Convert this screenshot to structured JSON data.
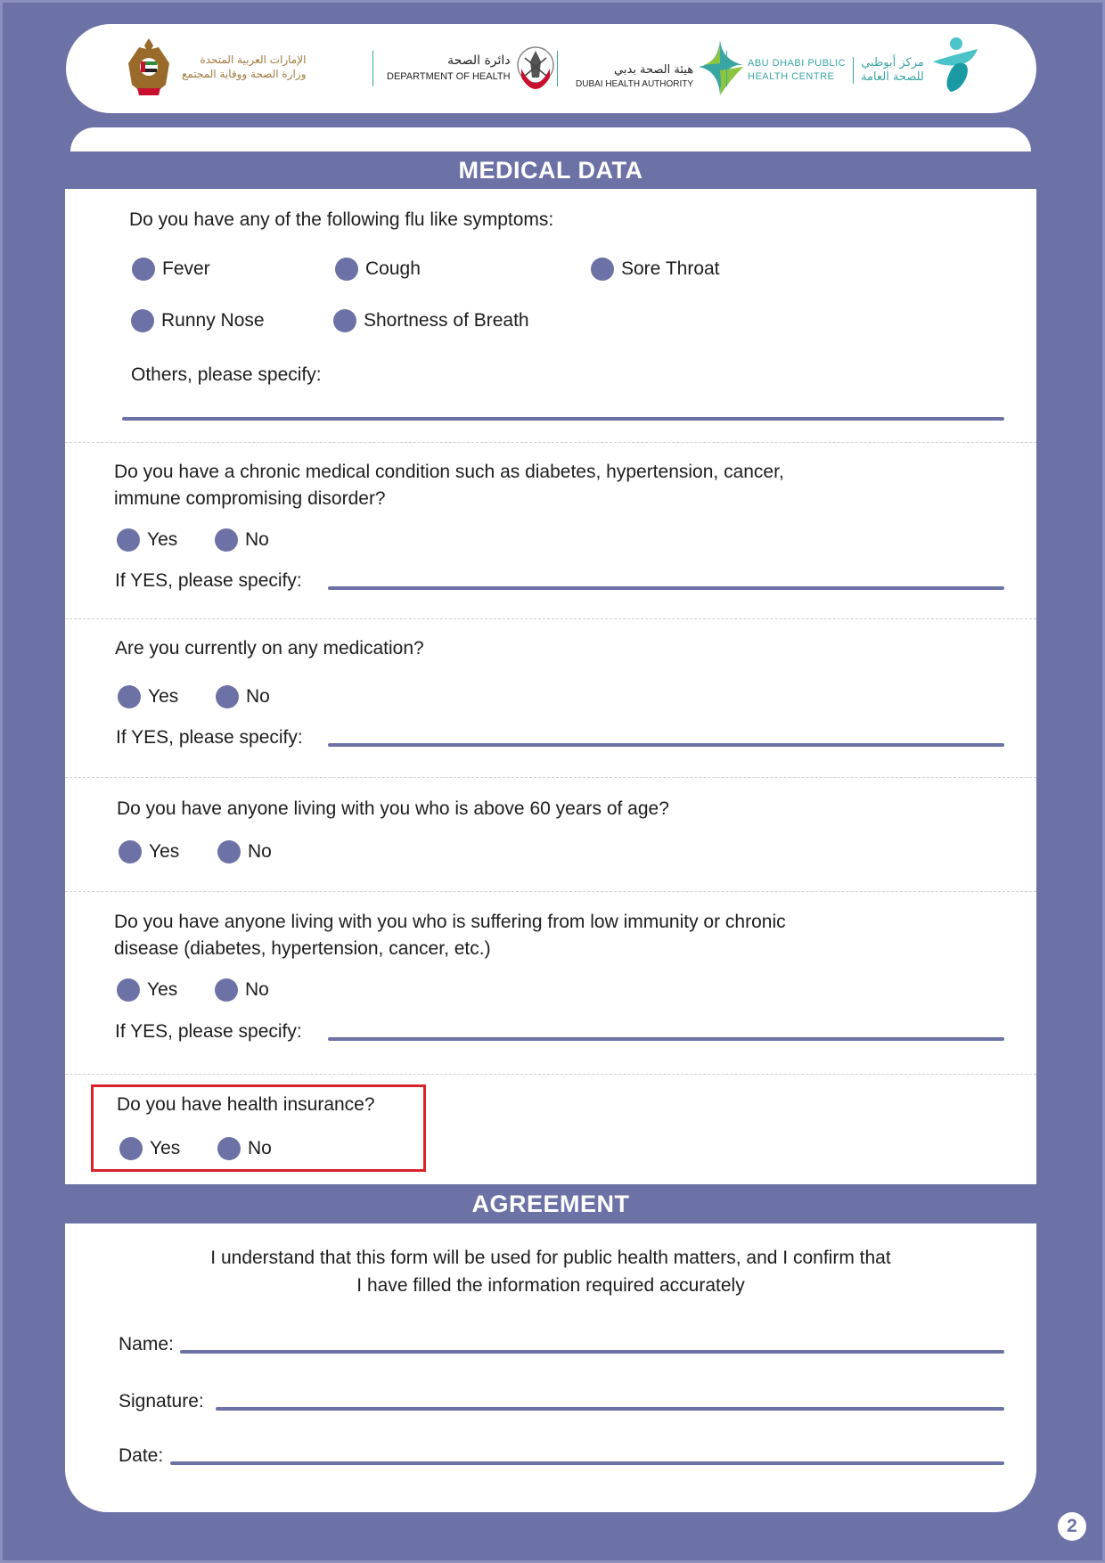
{
  "header": {
    "logos": [
      {
        "name": "uae-ministry",
        "arabic_line1": "الإمارات العربية المتحدة",
        "arabic_line2": "وزارة الصحة ووقاية المجتمع"
      },
      {
        "name": "abu-dhabi-doh",
        "arabic": "دائرة الصحة",
        "english": "DEPARTMENT OF HEALTH"
      },
      {
        "name": "dubai-health-authority",
        "arabic": "هيئة الصحة بدبي",
        "english": "DUBAI HEALTH AUTHORITY"
      },
      {
        "name": "abu-dhabi-public-health-centre",
        "english_line1": "ABU DHABI PUBLIC",
        "english_line2": "HEALTH CENTRE",
        "arabic_line1": "مركز أبوظبي",
        "arabic_line2": "للصحة العامة"
      }
    ]
  },
  "medical": {
    "title": "MEDICAL DATA",
    "symptoms": {
      "question": "Do you have any of the following flu like symptoms:",
      "options": [
        "Fever",
        "Cough",
        "Sore Throat",
        "Runny Nose",
        "Shortness of Breath"
      ],
      "others_label": "Others, please specify:"
    },
    "chronic": {
      "question_line1": "Do you have a chronic medical condition such as diabetes, hypertension, cancer,",
      "question_line2": "immune compromising disorder?",
      "yes": "Yes",
      "no": "No",
      "specify_label": "If YES, please specify:"
    },
    "medication": {
      "question": "Are you currently on any medication?",
      "yes": "Yes",
      "no": "No",
      "specify_label": "If YES, please specify:"
    },
    "above60": {
      "question": "Do you have anyone living with you who is above 60 years of age?",
      "yes": "Yes",
      "no": "No"
    },
    "low_immunity": {
      "question_line1": "Do you have anyone living with you who is suffering from low immunity or chronic",
      "question_line2": "disease (diabetes, hypertension, cancer, etc.)",
      "yes": "Yes",
      "no": "No",
      "specify_label": "If YES, please specify:"
    },
    "insurance": {
      "question": "Do you have health insurance?",
      "yes": "Yes",
      "no": "No",
      "highlight_color": "#d9222a"
    }
  },
  "agreement": {
    "title": "AGREEMENT",
    "text_line1": "I understand that this form will be used for public health matters, and I confirm that",
    "text_line2": "I have filled the information required accurately",
    "name_label": "Name:",
    "signature_label": "Signature:",
    "date_label": "Date:"
  },
  "page_number": "2",
  "colors": {
    "brand_purple": "#6c71a6",
    "highlight_red": "#d9222a",
    "teal": "#3aa6a3"
  }
}
